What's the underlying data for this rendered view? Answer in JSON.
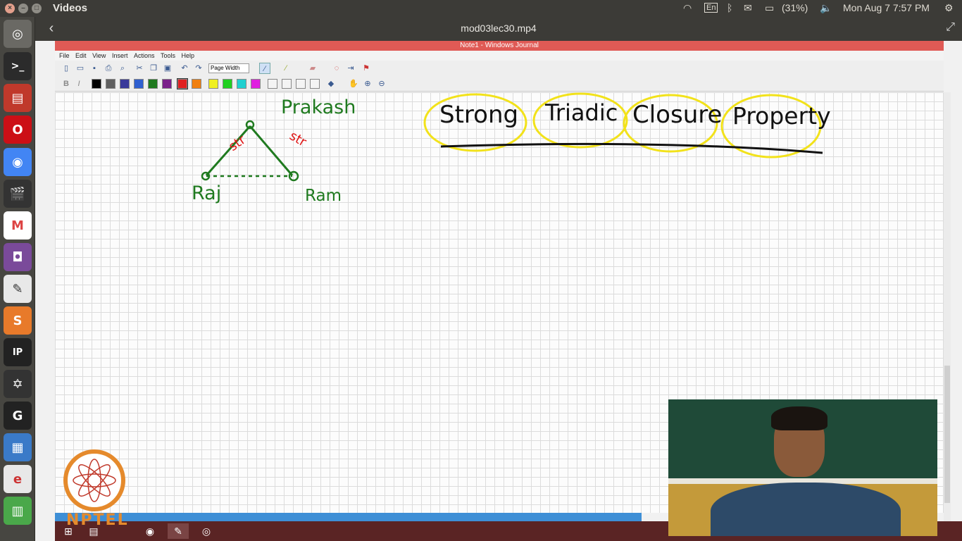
{
  "topbar": {
    "app_title": "Videos",
    "keyboard": "En",
    "battery": "(31%)",
    "datetime": "Mon Aug 7 7:57 PM"
  },
  "video_header": {
    "title": "mod03lec30.mp4"
  },
  "journal": {
    "window_title": "Note1 - Windows Journal",
    "menu": [
      "File",
      "Edit",
      "View",
      "Insert",
      "Actions",
      "Tools",
      "Help"
    ],
    "zoom_select": "Page Width",
    "swatches": [
      "#000000",
      "#606060",
      "#3a3a9a",
      "#3060d0",
      "#1f7a1f",
      "#7a1f8a",
      "#e02020",
      "#f08010",
      "#f0f020",
      "#20d020",
      "#20d0d0",
      "#e020e0"
    ]
  },
  "canvas": {
    "heading_words": [
      "Strong",
      "Triadic",
      "Closure",
      "Property"
    ],
    "nodes": [
      "Prakash",
      "Raj",
      "Ram"
    ],
    "edge_labels": [
      "str",
      "str"
    ]
  },
  "watermark": "NPTEL"
}
